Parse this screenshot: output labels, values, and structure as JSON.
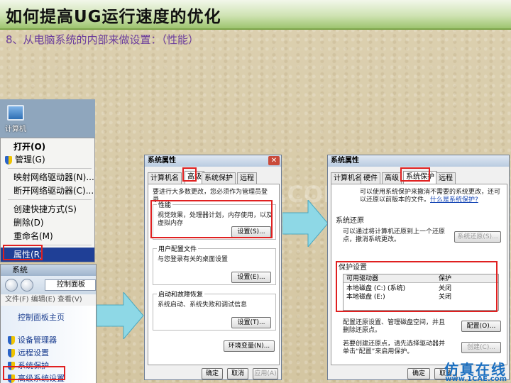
{
  "slide": {
    "title": "如何提高UG运行速度的优化",
    "subtitle": "8、从电脑系统的内部来做设置：（性能）"
  },
  "desktop": {
    "icon_label": "计算机"
  },
  "context_menu": {
    "items": [
      "打开(O)",
      "管理(G)",
      "映射网络驱动器(N)...",
      "断开网络驱动器(C)...",
      "创建快捷方式(S)",
      "删除(D)",
      "重命名(M)",
      "属性(R)"
    ],
    "selected": "属性(R)"
  },
  "system_window": {
    "title": "系统",
    "address": "控制面板",
    "menu": "文件(F)  编辑(E)  查看(V)",
    "home": "控制面板主页",
    "links": [
      "设备管理器",
      "远程设置",
      "系统保护",
      "高级系统设置"
    ]
  },
  "dialog_advanced": {
    "title": "系统属性",
    "tabs": [
      "计算机名",
      "硬件",
      "高级",
      "系统保护",
      "远程"
    ],
    "active_tab": "高级",
    "admin_note": "要进行大多数更改，您必须作为管理员登录。",
    "perf_title": "性能",
    "perf_desc": "视觉效果，处理器计划，内存使用，以及虚拟内存",
    "profile_title": "用户配置文件",
    "profile_desc": "与您登录有关的桌面设置",
    "startup_title": "启动和故障恢复",
    "startup_desc": "系统启动、系统失败和调试信息",
    "settings_btn": "设置(S)...",
    "settings_btn2": "设置(E)...",
    "settings_btn3": "设置(T)...",
    "env_btn": "环境变量(N)...",
    "ok": "确定",
    "cancel": "取消",
    "apply": "应用(A)"
  },
  "dialog_protection": {
    "title": "系统属性",
    "tabs": [
      "计算机名",
      "硬件",
      "高级",
      "系统保护",
      "远程"
    ],
    "active_tab": "系统保护",
    "intro": "可以使用系统保护来撤消不需要的系统更改，还可以还原以前版本的文件。",
    "intro_link": "什么是系统保护?",
    "restore_title": "系统还原",
    "restore_desc": "可以通过将计算机还原到上一个还原点，撤消系统更改。",
    "restore_btn": "系统还原(S)...",
    "protect_title": "保护设置",
    "col_drive": "可用驱动器",
    "col_protect": "保护",
    "drives": [
      {
        "name": "本地磁盘 (C:) (系统)",
        "status": "关闭"
      },
      {
        "name": "本地磁盘 (E:)",
        "status": "关闭"
      }
    ],
    "config_desc": "配置还原设置、管理磁盘空间，并且删除还原点。",
    "config_btn": "配置(O)...",
    "create_desc": "若要创建还原点，请先选择驱动器并单击“配置”来启用保护。",
    "create_btn": "创建(C)...",
    "ok": "确定",
    "cancel": "取消"
  },
  "watermark": "1CAE.COM",
  "branding": {
    "text": "仿真在线",
    "url": "www.1CAE.com"
  },
  "colors": {
    "highlight": "#e02020",
    "arrow": "#8ed8e6",
    "selection": "#1f3f96"
  }
}
